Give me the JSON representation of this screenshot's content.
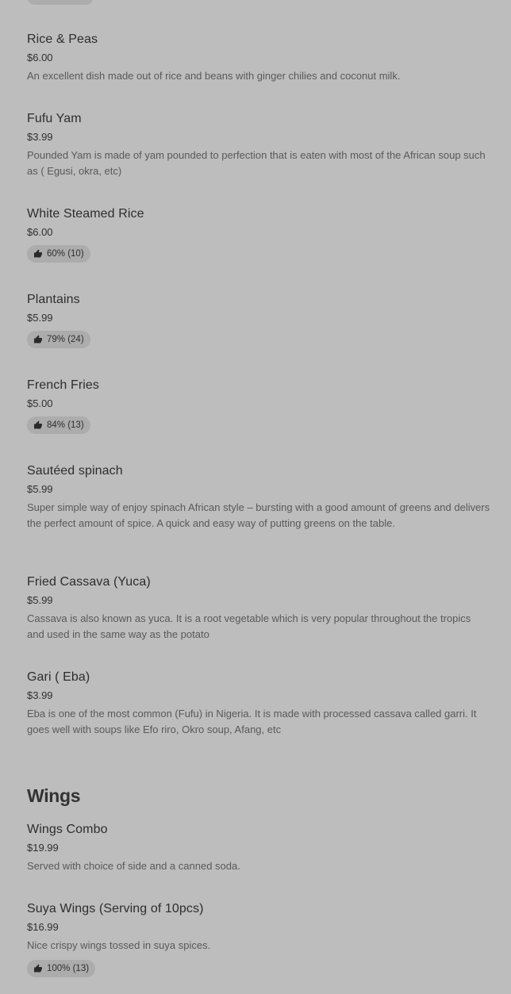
{
  "sections": [
    {
      "items": [
        {
          "name": "Rice & Peas",
          "price": "$6.00",
          "description": "An excellent dish made out of rice and beans with ginger chilies and coconut milk."
        },
        {
          "name": "Fufu Yam",
          "price": "$3.99",
          "description": "Pounded Yam is made of yam pounded to perfection that is eaten with most of the African soup such as ( Egusi, okra, etc)"
        },
        {
          "name": "White Steamed Rice",
          "price": "$6.00",
          "rating": "60% (10)"
        },
        {
          "name": "Plantains",
          "price": "$5.99",
          "rating": "79% (24)"
        },
        {
          "name": "French Fries",
          "price": "$5.00",
          "rating": "84% (13)"
        },
        {
          "name": "Sautéed spinach",
          "price": "$5.99",
          "description": "Super simple way of enjoy spinach African style – bursting with a good amount of greens and delivers the perfect amount of spice. A quick and easy way of putting greens on the table."
        },
        {
          "name": "Fried Cassava (Yuca)",
          "price": "$5.99",
          "description": "Cassava is also known as  yuca.  It is a  root vegetable which is very  popular throughout the tropics and used in the same way as the potato"
        },
        {
          "name": "Gari ( Eba)",
          "price": "$3.99",
          "description": "Eba is one of the most common (Fufu) in Nigeria. It is made with processed cassava called garri. It goes well with soups like Efo riro, Okro soup, Afang, etc"
        }
      ]
    },
    {
      "title": "Wings",
      "items": [
        {
          "name": "Wings Combo",
          "price": "$19.99",
          "description": "Served with choice of side and a canned soda."
        },
        {
          "name": "Suya Wings (Serving of 10pcs)",
          "price": "$16.99",
          "description": "Nice crispy wings tossed in suya spices.",
          "rating": "100% (13)"
        }
      ]
    }
  ],
  "icons": {
    "rating": "thumbs-up-icon"
  }
}
